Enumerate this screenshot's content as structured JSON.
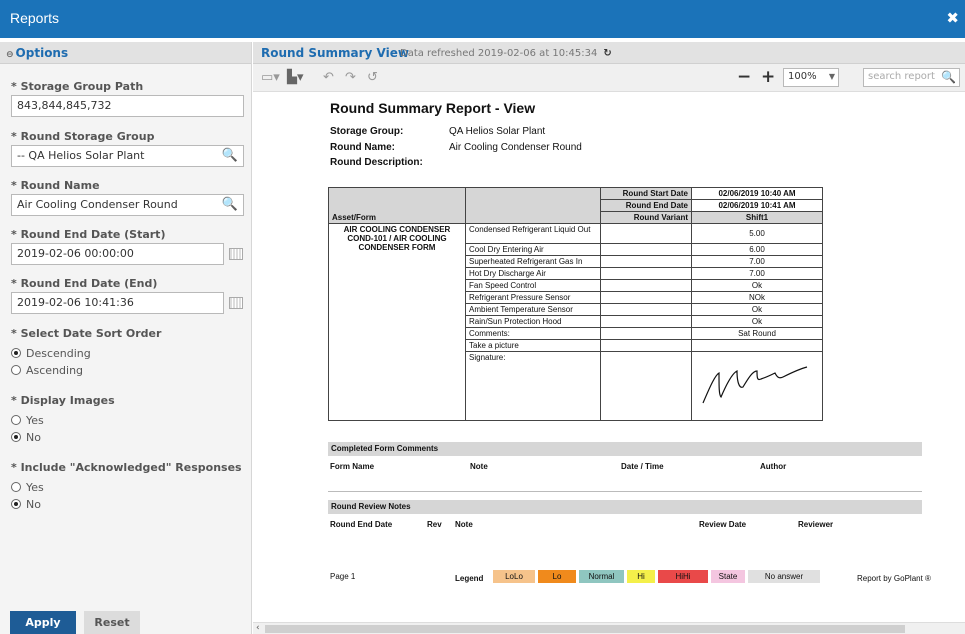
{
  "window": {
    "title": "Reports",
    "close_glyph": "✖"
  },
  "options": {
    "header": "Options",
    "storage_group_path": {
      "label": "* Storage Group Path",
      "value": "843,844,845,732"
    },
    "round_storage_group": {
      "label": "* Round Storage Group",
      "value": "-- QA Helios Solar Plant"
    },
    "round_name": {
      "label": "* Round Name",
      "value": "Air Cooling Condenser Round"
    },
    "round_end_start": {
      "label": "* Round End Date (Start)",
      "value": "2019-02-06 00:00:00"
    },
    "round_end_end": {
      "label": "* Round End Date (End)",
      "value": "2019-02-06 10:41:36"
    },
    "sort_order": {
      "label": "* Select Date Sort Order",
      "options": [
        "Descending",
        "Ascending"
      ],
      "selected": "Descending"
    },
    "display_images": {
      "label": "* Display Images",
      "options": [
        "Yes",
        "No"
      ],
      "selected": "No"
    },
    "include_ack": {
      "label": "* Include \"Acknowledged\" Responses",
      "options": [
        "Yes",
        "No"
      ],
      "selected": "No"
    },
    "apply": "Apply",
    "reset": "Reset"
  },
  "report_header": {
    "title": "Round Summary View",
    "refresh": "Data refreshed 2019-02-06 at 10:45:34",
    "refresh_icon": "↻"
  },
  "toolbar": {
    "zoom": "100%",
    "search_placeholder": "search report",
    "zoom_minus": "−",
    "zoom_plus": "+"
  },
  "report": {
    "title": "Round Summary Report - View",
    "storage_group_label": "Storage Group:",
    "storage_group_value": "QA Helios Solar Plant",
    "round_name_label": "Round Name:",
    "round_name_value": "Air Cooling Condenser Round",
    "round_desc_label": "Round Description:",
    "round_start_label": "Round Start Date",
    "round_start_value": "02/06/2019 10:40 AM",
    "round_end_label": "Round End Date",
    "round_end_value": "02/06/2019 10:41 AM",
    "round_variant_label": "Round Variant",
    "round_variant_value": "Shift1",
    "asset_form_label": "Asset/Form",
    "asset_form_value": "AIR COOLING CONDENSER COND-101 / AIR COOLING CONDENSER FORM",
    "rows": [
      {
        "q": "Condensed Refrigerant Liquid Out",
        "v": "5.00"
      },
      {
        "q": "Cool Dry Entering Air",
        "v": "6.00"
      },
      {
        "q": "Superheated Refrigerant Gas In",
        "v": "7.00"
      },
      {
        "q": "Hot Dry Discharge Air",
        "v": "7.00"
      },
      {
        "q": "Fan Speed Control",
        "v": "Ok"
      },
      {
        "q": "Refrigerant Pressure Sensor",
        "v": "NOk"
      },
      {
        "q": "Ambient Temperature Sensor",
        "v": "Ok"
      },
      {
        "q": "Rain/Sun Protection Hood",
        "v": "Ok"
      },
      {
        "q": "Comments:",
        "v": "Sat Round"
      },
      {
        "q": "Take a picture",
        "v": ""
      },
      {
        "q": "Signature:",
        "v": ""
      }
    ],
    "completed_comments": {
      "title": "Completed Form Comments",
      "cols": [
        "Form Name",
        "Note",
        "Date / Time",
        "Author"
      ]
    },
    "review_notes": {
      "title": "Round Review Notes",
      "cols": [
        "Round End Date",
        "Rev",
        "Note",
        "Review Date",
        "Reviewer"
      ]
    },
    "footer": {
      "page": "Page 1",
      "legend_label": "Legend",
      "legend": [
        {
          "name": "LoLo",
          "color": "#f6c38b"
        },
        {
          "name": "Lo",
          "color": "#f08a1c"
        },
        {
          "name": "Normal",
          "color": "#8fc6c0"
        },
        {
          "name": "Hi",
          "color": "#f4f04a"
        },
        {
          "name": "HiHi",
          "color": "#e94949"
        },
        {
          "name": "State",
          "color": "#f4c6e0"
        },
        {
          "name": "No answer",
          "color": "#e0e0e0"
        }
      ],
      "credit": "Report by GoPlant ®"
    }
  }
}
